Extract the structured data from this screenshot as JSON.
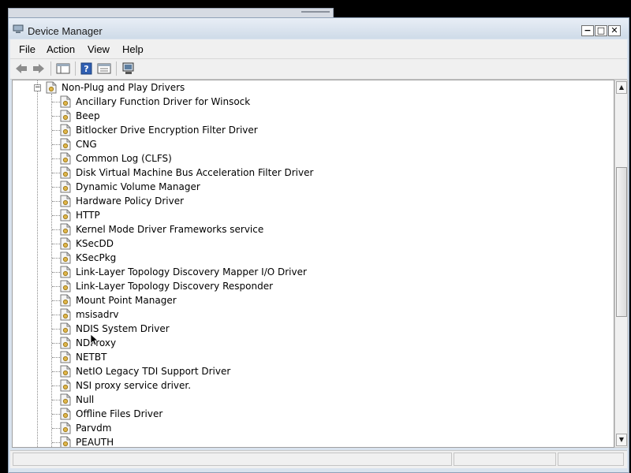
{
  "window": {
    "title": "Device Manager"
  },
  "menu": [
    "File",
    "Action",
    "View",
    "Help"
  ],
  "toolbar": {
    "buttons": [
      "back-icon",
      "forward-icon",
      "console-tree-icon",
      "help-icon",
      "properties-icon",
      "scan-hardware-icon"
    ]
  },
  "tree": {
    "group": {
      "label": "Non-Plug and Play Drivers",
      "expander": "−"
    },
    "items": [
      "Ancillary Function Driver for Winsock",
      "Beep",
      "Bitlocker Drive Encryption Filter Driver",
      "CNG",
      "Common Log (CLFS)",
      "Disk Virtual Machine Bus Acceleration Filter Driver",
      "Dynamic Volume Manager",
      "Hardware Policy Driver",
      "HTTP",
      "Kernel Mode Driver Frameworks service",
      "KSecDD",
      "KSecPkg",
      "Link-Layer Topology Discovery Mapper I/O Driver",
      "Link-Layer Topology Discovery Responder",
      "Mount Point Manager",
      "msisadrv",
      "NDIS System Driver",
      "NDProxy",
      "NETBT",
      "NetIO Legacy TDI Support Driver",
      "NSI proxy service driver.",
      "Null",
      "Offline Files Driver",
      "Parvdm",
      "PEAUTH"
    ]
  },
  "scrollbar": {
    "up": "▲",
    "down": "▼"
  },
  "controls": {
    "minimize": "−",
    "maximize": "□",
    "close": "✕"
  }
}
